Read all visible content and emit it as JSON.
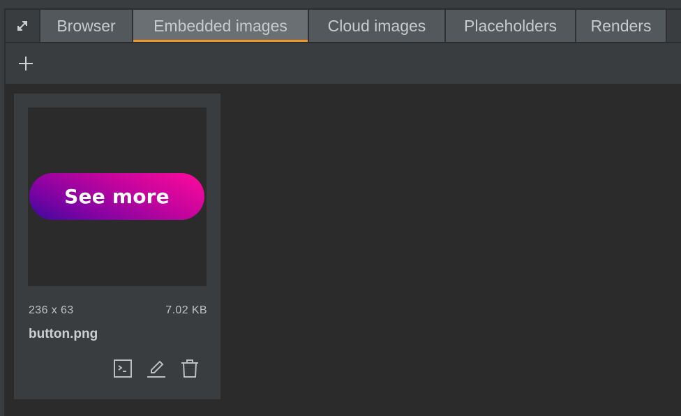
{
  "tabs": [
    {
      "label": "Browser",
      "active": false
    },
    {
      "label": "Embedded images",
      "active": true
    },
    {
      "label": "Cloud images",
      "active": false
    },
    {
      "label": "Placeholders",
      "active": false
    },
    {
      "label": "Renders",
      "active": false
    }
  ],
  "accent_color": "#f0962a",
  "toolbar": {
    "add_icon": "plus-icon"
  },
  "images": [
    {
      "preview_text": "See more",
      "dimensions": "236 x 63",
      "size": "7.02 KB",
      "filename": "button.png",
      "actions": [
        "terminal-icon",
        "pencil-icon",
        "trash-icon"
      ]
    }
  ]
}
